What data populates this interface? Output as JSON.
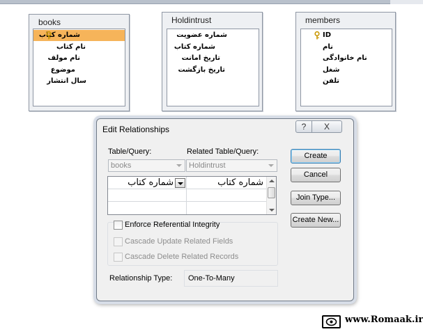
{
  "tables": [
    {
      "title": "books",
      "fields": [
        "شماره کتاب",
        "نام کتاب",
        "نام مولف",
        "موضوع",
        "سال انتشار"
      ]
    },
    {
      "title": "Holdintrust",
      "fields": [
        "شماره عضویت",
        "شماره کتاب",
        "تاریخ امانت",
        "تاریخ بازگشت"
      ]
    },
    {
      "title": "members",
      "fields": [
        "ID",
        "نام",
        "نام خانوادگی",
        "شغل",
        "تلفن"
      ]
    }
  ],
  "dialog": {
    "title": "Edit Relationships",
    "help_glyph": "?",
    "close_glyph": "X",
    "table_query_label": "Table/Query:",
    "related_label": "Related Table/Query:",
    "table_value": "books",
    "related_value": "Holdintrust",
    "grid_rows": [
      {
        "left": "شماره کتاب",
        "right": "شماره کتاب"
      }
    ],
    "buttons": {
      "create": "Create",
      "cancel": "Cancel",
      "join_type": "Join Type...",
      "create_new": "Create New..."
    },
    "enforce": "Enforce Referential Integrity",
    "cascade_update": "Cascade Update Related Fields",
    "cascade_delete": "Cascade Delete Related Records",
    "relationship_type_label": "Relationship Type:",
    "relationship_type_value": "One-To-Many"
  },
  "watermark": {
    "text": "www.Romaak.ir"
  },
  "colors": {
    "selected_field": "#f6b45a",
    "key_icon": "#e8b400"
  }
}
